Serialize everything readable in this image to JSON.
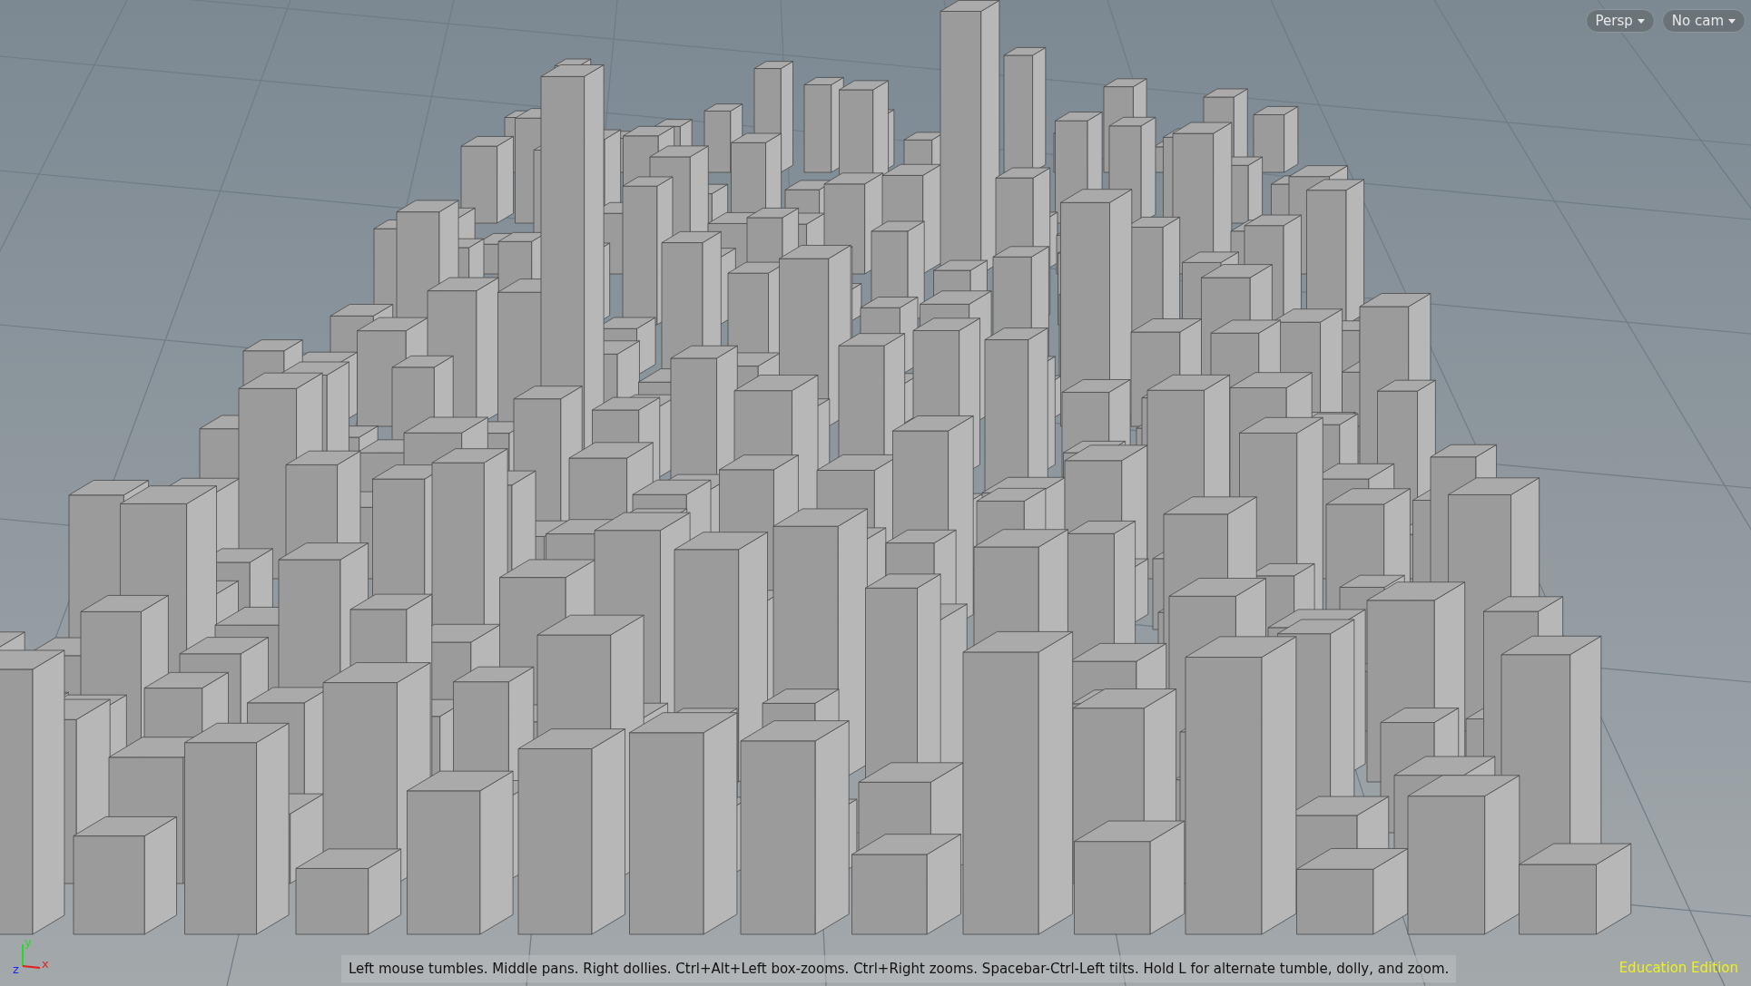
{
  "viewport": {
    "camera_menus": [
      {
        "label": "Persp"
      },
      {
        "label": "No cam"
      }
    ],
    "axes": [
      {
        "label": "y",
        "color": "#22dd22"
      },
      {
        "label": "x",
        "color": "#e02020"
      },
      {
        "label": "z",
        "color": "#2020ee"
      }
    ],
    "hint": "Left mouse tumbles. Middle pans. Right dollies. Ctrl+Alt+Left box-zooms. Ctrl+Right zooms. Spacebar-Ctrl-Left tilts. Hold L for alternate tumble, dolly, and zoom.",
    "edition": "Education Edition"
  }
}
